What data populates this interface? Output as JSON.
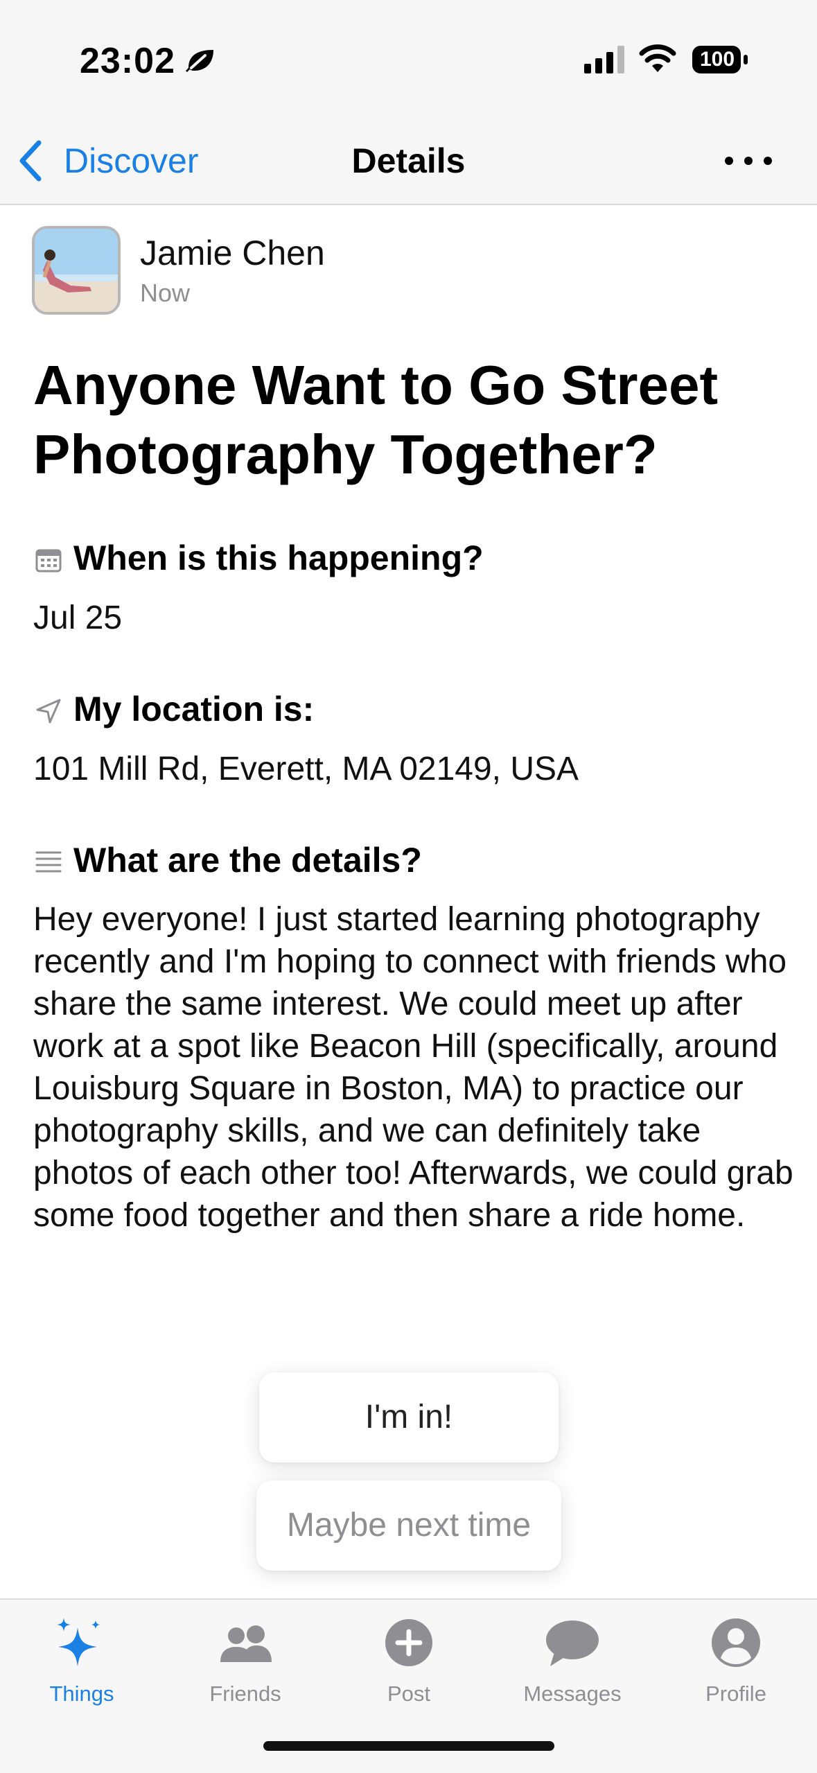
{
  "status_bar": {
    "time": "23:02",
    "battery": "100"
  },
  "nav": {
    "back_label": "Discover",
    "title": "Details"
  },
  "post": {
    "author_name": "Jamie Chen",
    "posted_time": "Now",
    "title": "Anyone Want to Go Street Photography Together?",
    "when_heading": "When is this happening?",
    "when_value": "Jul 25",
    "location_heading": "My location is:",
    "location_value": "101 Mill Rd, Everett, MA 02149, USA",
    "details_heading": "What are the details?",
    "details_body": "Hey everyone! I just started learning photography recently and I'm hoping to connect with friends who share the same interest. We could meet up after work at a spot like Beacon Hill (specifically, around Louisburg Square in Boston, MA) to practice our photography skills, and we can definitely take photos of each other too! Afterwards, we could grab some food together and then share a ride home."
  },
  "actions": {
    "join_label": "I'm in!",
    "decline_label": "Maybe next time"
  },
  "tabs": [
    {
      "label": "Things",
      "icon": "sparkles-icon",
      "active": true
    },
    {
      "label": "Friends",
      "icon": "people-icon",
      "active": false
    },
    {
      "label": "Post",
      "icon": "plus-circle-icon",
      "active": false
    },
    {
      "label": "Messages",
      "icon": "chat-bubble-icon",
      "active": false
    },
    {
      "label": "Profile",
      "icon": "person-circle-icon",
      "active": false
    }
  ],
  "colors": {
    "accent": "#1a80e6",
    "inactive": "#8e8e93",
    "bar_background": "#f6f6f6"
  }
}
